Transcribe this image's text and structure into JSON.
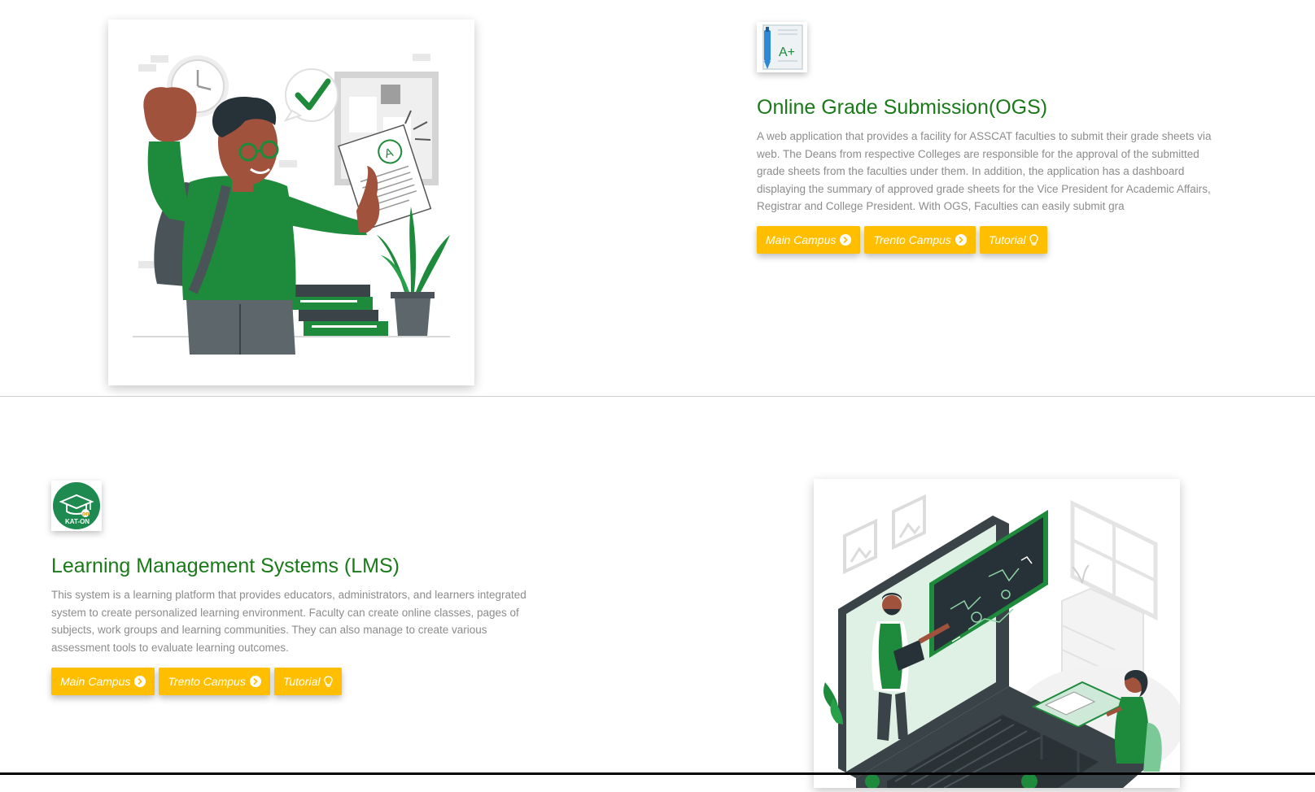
{
  "colors": {
    "title_green": "#1a7a1a",
    "button_yellow": "#ffbf00",
    "text_gray": "#8c8c8c",
    "illustration_green": "#1e8a3c"
  },
  "ogs": {
    "title": "Online Grade Submission(OGS)",
    "description": "A web application that provides a facility for ASSCAT faculties to submit their grade sheets via web. The Deans from respective Colleges are responsible for the approval of the submitted grade sheets from the faculties under them. In addition, the application has a dashboard displaying the summary of approved grade sheets for the Vice President for Academic Affairs, Registrar and College President. With OGS, Faculties can easily submit gra",
    "logo_icon": "grade-sheet-icon",
    "logo_text": "A+",
    "buttons": {
      "main_campus": "Main Campus",
      "trento_campus": "Trento Campus",
      "tutorial": "Tutorial"
    }
  },
  "lms": {
    "title": "Learning Management Systems (LMS)",
    "description": "This system is a learning platform that provides educators, administrators, and learners integrated system to create personalized learning environment. Faculty can create online classes, pages of subjects, work groups and learning communities. They can also manage to create various assessment tools to evaluate learning outcomes.",
    "logo_icon": "graduation-cap-icon",
    "logo_text": "KAT-ON",
    "buttons": {
      "main_campus": "Main Campus",
      "trento_campus": "Trento Campus",
      "tutorial": "Tutorial"
    }
  }
}
